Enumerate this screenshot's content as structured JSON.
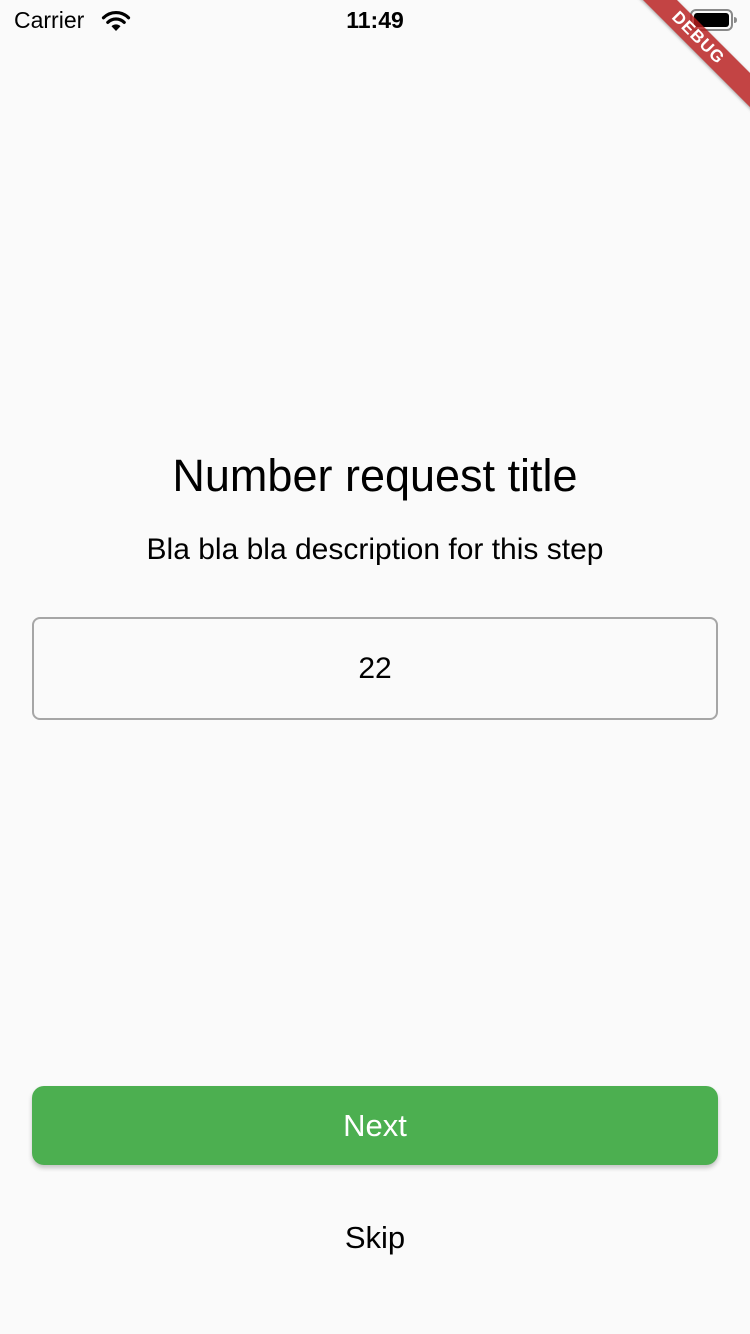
{
  "status_bar": {
    "carrier": "Carrier",
    "time": "11:49",
    "icons": [
      "wifi-icon",
      "battery-icon"
    ]
  },
  "debug_banner": "DEBUG",
  "main": {
    "title": "Number request title",
    "description": "Bla bla bla description for this step",
    "number_input_value": "22"
  },
  "actions": {
    "next_label": "Next",
    "skip_label": "Skip"
  },
  "colors": {
    "primary": "#4caf50",
    "background": "#fafafa",
    "input_border": "#a6a6a6",
    "debug_ribbon": "#b71c1c"
  }
}
